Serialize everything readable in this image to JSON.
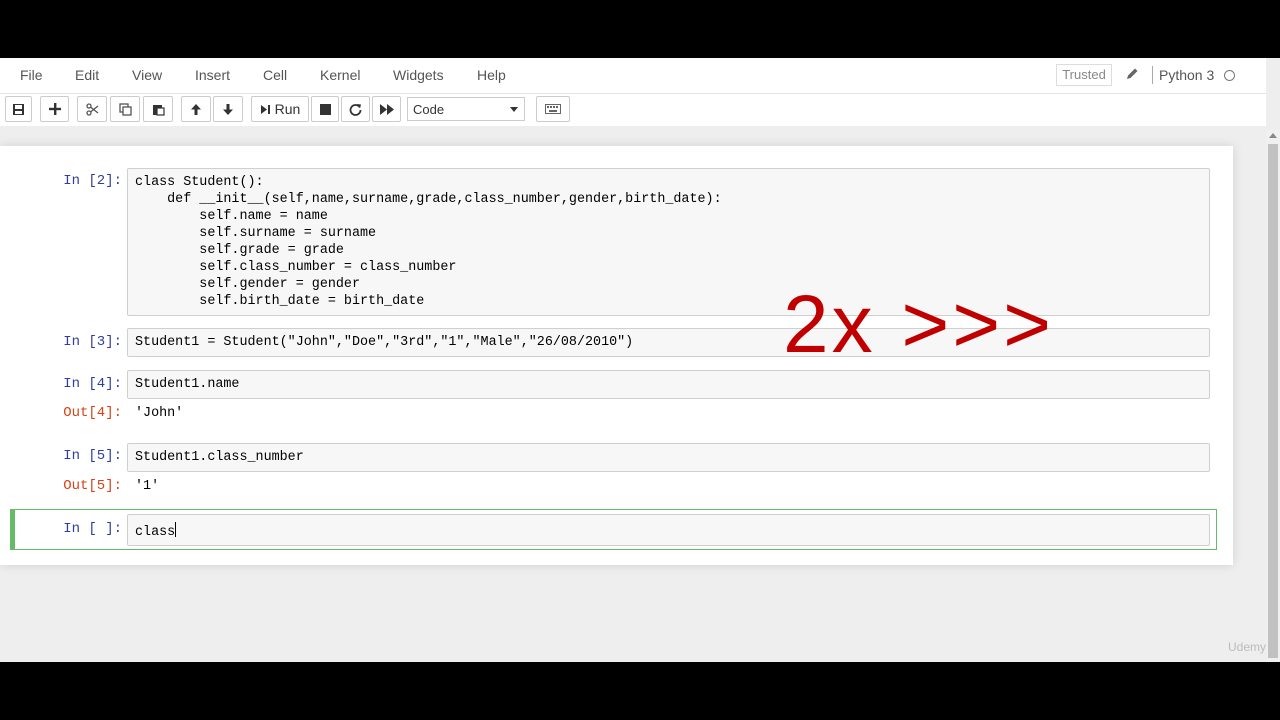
{
  "menu": [
    "File",
    "Edit",
    "View",
    "Insert",
    "Cell",
    "Kernel",
    "Widgets",
    "Help"
  ],
  "header": {
    "trusted": "Trusted",
    "kernel": "Python 3"
  },
  "toolbar": {
    "run_label": "Run",
    "cell_type": "Code"
  },
  "cells": [
    {
      "prompt": "In [2]:",
      "source": "class Student():\n    def __init__(self,name,surname,grade,class_number,gender,birth_date):\n        self.name = name\n        self.surname = surname\n        self.grade = grade\n        self.class_number = class_number\n        self.gender = gender\n        self.birth_date = birth_date"
    },
    {
      "prompt": "In [3]:",
      "source": "Student1 = Student(\"John\",\"Doe\",\"3rd\",\"1\",\"Male\",\"26/08/2010\")"
    },
    {
      "prompt": "In [4]:",
      "source": "Student1.name",
      "out_prompt": "Out[4]:",
      "output": "'John'"
    },
    {
      "prompt": "In [5]:",
      "source": "Student1.class_number",
      "out_prompt": "Out[5]:",
      "output": "'1'"
    },
    {
      "prompt": "In [ ]:",
      "source": "class"
    }
  ],
  "overlay_text": "2x >>>",
  "watermark": "Udemy"
}
